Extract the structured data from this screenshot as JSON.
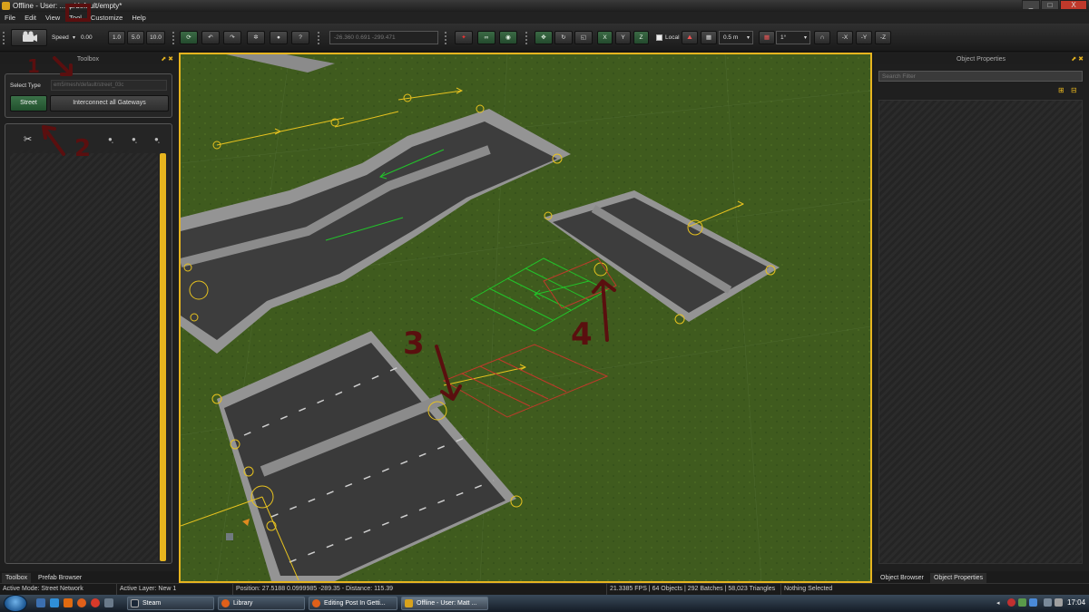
{
  "window": {
    "title": "Offline - User: ...ap/default/empty*",
    "buttons": [
      "_",
      "□",
      "X"
    ]
  },
  "menu": [
    "File",
    "Edit",
    "View",
    "Tool",
    "Customize",
    "Help"
  ],
  "toolbar": {
    "speed_label": "Speed",
    "speed_value": "0.00",
    "speed_presets": [
      "1.0",
      "5.0",
      "10.0"
    ],
    "coords_field": "-26.360 0.691 -299.471",
    "axis_buttons": [
      "X",
      "Y",
      "Z"
    ],
    "local_label": "Local",
    "grid_value": "0.5 m",
    "angle_value": "1°",
    "neg_axis_buttons": [
      "-X",
      "-Y",
      "-Z"
    ]
  },
  "toolbox": {
    "title": "Toolbox",
    "select_type_label": "Select Type",
    "select_type_value": "em5/mesh/default/street_03c",
    "street_button": "Street",
    "interconnect_button": "Interconnect all Gateways"
  },
  "left_tabs": [
    "Toolbox",
    "Prefab Browser"
  ],
  "object_properties": {
    "title": "Object Properties",
    "search_placeholder": "Search Filter"
  },
  "right_tabs": [
    "Object Browser",
    "Object Properties"
  ],
  "annotations": [
    "1",
    "2",
    "3",
    "4"
  ],
  "status": {
    "mode": "Active Mode: Street Network",
    "layer": "Active Layer: New 1",
    "position": "Position: 27.5188 0.0999985 -289.35 - Distance: 115.39",
    "stats": "21.3385 FPS | 64 Objects | 292 Batches | 58,023 Triangles",
    "selection": "Nothing Selected"
  },
  "taskbar": {
    "tasks": [
      "Steam",
      "Library",
      "Editing Post In Getti...",
      "Offline - User: Matt ..."
    ],
    "clock": "17:04"
  },
  "colors": {
    "accent_yellow": "#e7b51f",
    "annotation_red": "#5a0f0f",
    "street_green": "#2f6a3c",
    "grass": "#3d5a1c",
    "gateway_green": "#22c52a"
  }
}
